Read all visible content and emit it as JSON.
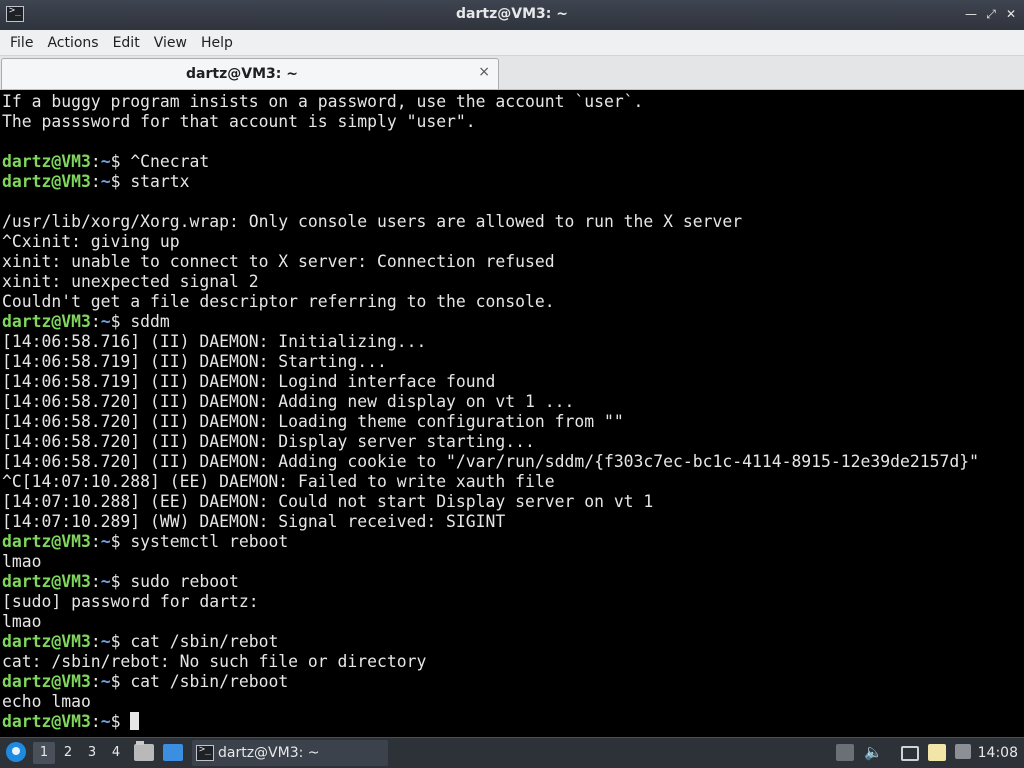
{
  "window": {
    "title": "dartz@VM3: ~",
    "icon": "terminal-icon",
    "controls": [
      "minimize-icon",
      "maximize-icon",
      "close-icon"
    ]
  },
  "menu": {
    "file": "File",
    "actions": "Actions",
    "edit": "Edit",
    "view": "View",
    "help": "Help"
  },
  "tab": {
    "label": "dartz@VM3: ~",
    "close": "×"
  },
  "prompt": {
    "user": "dartz@VM3",
    "colon": ":",
    "path": "~",
    "dollar": "$ "
  },
  "terminal_lines": [
    {
      "type": "text",
      "text": "If a buggy program insists on a password, use the account `user`."
    },
    {
      "type": "text",
      "text": "The passsword for that account is simply \"user\"."
    },
    {
      "type": "text",
      "text": ""
    },
    {
      "type": "prompt",
      "text": "^Cnecrat"
    },
    {
      "type": "prompt",
      "text": "startx"
    },
    {
      "type": "text",
      "text": ""
    },
    {
      "type": "text",
      "text": "/usr/lib/xorg/Xorg.wrap: Only console users are allowed to run the X server"
    },
    {
      "type": "text",
      "text": "^Cxinit: giving up"
    },
    {
      "type": "text",
      "text": "xinit: unable to connect to X server: Connection refused"
    },
    {
      "type": "text",
      "text": "xinit: unexpected signal 2"
    },
    {
      "type": "text",
      "text": "Couldn't get a file descriptor referring to the console."
    },
    {
      "type": "prompt",
      "text": "sddm"
    },
    {
      "type": "text",
      "text": "[14:06:58.716] (II) DAEMON: Initializing..."
    },
    {
      "type": "text",
      "text": "[14:06:58.719] (II) DAEMON: Starting..."
    },
    {
      "type": "text",
      "text": "[14:06:58.719] (II) DAEMON: Logind interface found"
    },
    {
      "type": "text",
      "text": "[14:06:58.720] (II) DAEMON: Adding new display on vt 1 ..."
    },
    {
      "type": "text",
      "text": "[14:06:58.720] (II) DAEMON: Loading theme configuration from \"\""
    },
    {
      "type": "text",
      "text": "[14:06:58.720] (II) DAEMON: Display server starting..."
    },
    {
      "type": "text",
      "text": "[14:06:58.720] (II) DAEMON: Adding cookie to \"/var/run/sddm/{f303c7ec-bc1c-4114-8915-12e39de2157d}\""
    },
    {
      "type": "text",
      "text": "^C[14:07:10.288] (EE) DAEMON: Failed to write xauth file"
    },
    {
      "type": "text",
      "text": "[14:07:10.288] (EE) DAEMON: Could not start Display server on vt 1"
    },
    {
      "type": "text",
      "text": "[14:07:10.289] (WW) DAEMON: Signal received: SIGINT"
    },
    {
      "type": "prompt",
      "text": "systemctl reboot"
    },
    {
      "type": "text",
      "text": "lmao"
    },
    {
      "type": "prompt",
      "text": "sudo reboot"
    },
    {
      "type": "text",
      "text": "[sudo] password for dartz:"
    },
    {
      "type": "text",
      "text": "lmao"
    },
    {
      "type": "prompt",
      "text": "cat /sbin/rebot"
    },
    {
      "type": "text",
      "text": "cat: /sbin/rebot: No such file or directory"
    },
    {
      "type": "prompt",
      "text": "cat /sbin/reboot"
    },
    {
      "type": "text",
      "text": "echo lmao"
    },
    {
      "type": "prompt",
      "text": "",
      "cursor": true
    }
  ],
  "taskbar": {
    "desktops": [
      "1",
      "2",
      "3",
      "4"
    ],
    "active_desktop": "1",
    "task_label": "dartz@VM3: ~",
    "clock": "14:08",
    "tray_icons": [
      "network-icon",
      "volume-icon",
      "display-icon",
      "clipboard-icon",
      "updates-icon"
    ]
  },
  "colors": {
    "prompt_user": "#7fd85b",
    "prompt_path": "#6aa6e8",
    "terminal_bg": "#000000",
    "terminal_fg": "#e6e6e6"
  }
}
